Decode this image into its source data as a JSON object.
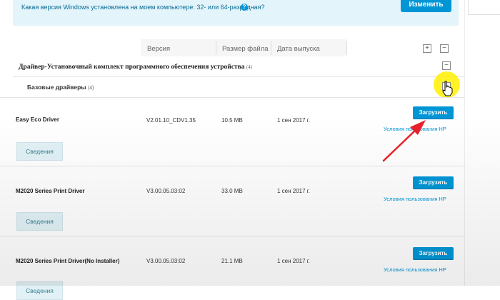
{
  "info": {
    "question": "Какая версия Windows установлена на моем компьютере: 32- или 64-разрядная?",
    "help_glyph": "?",
    "change_label": "Изменить"
  },
  "columns": {
    "version": "Версия",
    "file_size": "Размер файла",
    "release_date": "Дата выпуска"
  },
  "toolbar": {
    "expand_all": "+",
    "collapse_all": "−"
  },
  "category": {
    "title": "Драйвер-Установочный комплект программного обеспечения устройства",
    "count": "(4)",
    "toggle": "−"
  },
  "subcategory": {
    "title": "Базовые драйверы",
    "count": "(4)",
    "toggle": "+"
  },
  "drivers": [
    {
      "name": "Easy Eco Driver",
      "version": "V2.01.10_CDV1.35",
      "size": "10.5 MB",
      "date": "1 сен 2017 г.",
      "download": "Загрузить",
      "terms": "Условия пользования HP",
      "details": "Сведения"
    },
    {
      "name": "M2020 Series Print Driver",
      "version": "V3.00.05.03:02",
      "size": "33.0 MB",
      "date": "1 сен 2017 г.",
      "download": "Загрузить",
      "terms": "Условия пользования HP",
      "details": "Сведения"
    },
    {
      "name": "M2020 Series Print Driver(No Installer)",
      "version": "V3.00.05.03:02",
      "size": "21.1 MB",
      "date": "1 сен 2017 г.",
      "download": "Загрузить",
      "terms": "Условия пользования HP",
      "details": "Сведения"
    }
  ],
  "colors": {
    "accent": "#0096d6",
    "info_bg": "#e3f4fa",
    "details_bg": "#e1f1f5",
    "arrow": "#e8202a",
    "highlight": "#fff000"
  }
}
